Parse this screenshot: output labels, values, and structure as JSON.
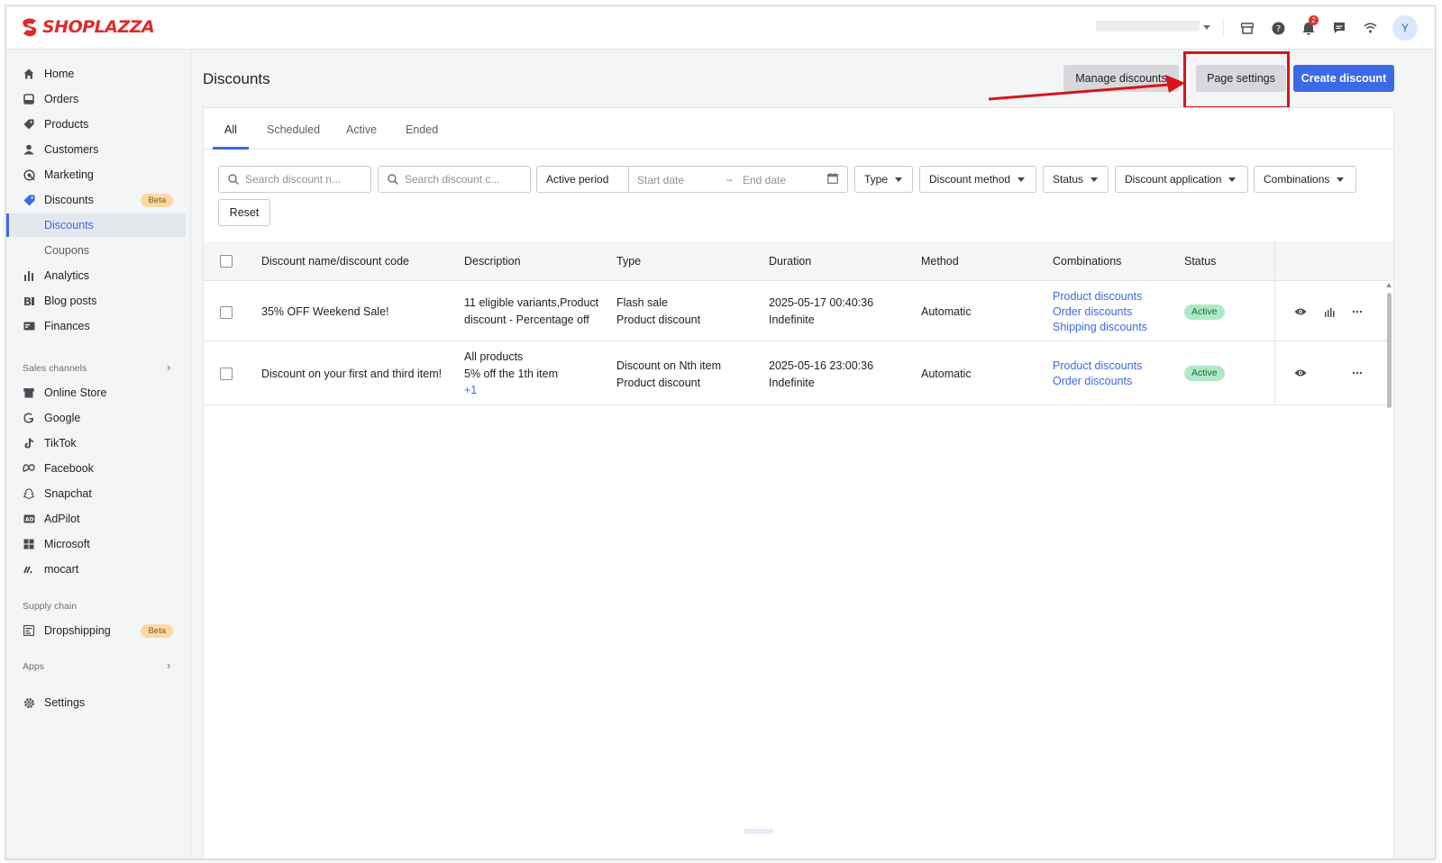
{
  "brand": {
    "name": "SHOPLAZZA",
    "color": "#e02a2a"
  },
  "topbar": {
    "icons": [
      "store-icon",
      "help-icon",
      "bell-icon",
      "chat-icon",
      "wifi-icon"
    ],
    "notification_count": "2",
    "avatar_initial": "Y"
  },
  "sidebar": {
    "items": [
      {
        "label": "Home",
        "icon": "home-icon"
      },
      {
        "label": "Orders",
        "icon": "orders-icon"
      },
      {
        "label": "Products",
        "icon": "tag-icon"
      },
      {
        "label": "Customers",
        "icon": "person-icon"
      },
      {
        "label": "Marketing",
        "icon": "marketing-icon"
      },
      {
        "label": "Discounts",
        "icon": "discount-icon",
        "badge": "Beta"
      },
      {
        "label": "Discounts"
      },
      {
        "label": "Coupons"
      },
      {
        "label": "Analytics",
        "icon": "bar-chart-icon"
      },
      {
        "label": "Blog posts",
        "icon": "blog-icon"
      },
      {
        "label": "Finances",
        "icon": "finance-icon"
      }
    ],
    "sales_channels_label": "Sales channels",
    "channels": [
      {
        "label": "Online Store",
        "icon": "store-icon"
      },
      {
        "label": "Google",
        "icon": "google-icon"
      },
      {
        "label": "TikTok",
        "icon": "tiktok-icon"
      },
      {
        "label": "Facebook",
        "icon": "meta-icon"
      },
      {
        "label": "Snapchat",
        "icon": "snapchat-icon"
      },
      {
        "label": "AdPilot",
        "icon": "adpilot-icon"
      },
      {
        "label": "Microsoft",
        "icon": "microsoft-icon"
      },
      {
        "label": "mocart",
        "icon": "mocart-icon"
      }
    ],
    "supply_chain_label": "Supply chain",
    "supply_items": [
      {
        "label": "Dropshipping",
        "icon": "dropshipping-icon",
        "badge": "Beta"
      }
    ],
    "apps_label": "Apps",
    "settings_label": "Settings"
  },
  "page": {
    "title": "Discounts",
    "manage_button": "Manage discounts",
    "page_settings_button": "Page settings",
    "create_button": "Create discount"
  },
  "tabs": [
    "All",
    "Scheduled",
    "Active",
    "Ended"
  ],
  "filters": {
    "search_name_placeholder": "Search discount n...",
    "search_code_placeholder": "Search discount c...",
    "active_period_label": "Active period",
    "start_date_placeholder": "Start date",
    "end_date_placeholder": "End date",
    "type": "Type",
    "method": "Discount method",
    "status": "Status",
    "application": "Discount application",
    "combinations": "Combinations",
    "reset": "Reset"
  },
  "table": {
    "headers": [
      "Discount name/discount code",
      "Description",
      "Type",
      "Duration",
      "Method",
      "Combinations",
      "Status"
    ],
    "rows": [
      {
        "name": "35% OFF Weekend Sale!",
        "description": [
          "11 eligible variants,Product",
          "discount - Percentage off"
        ],
        "type": [
          "Flash sale",
          "Product discount"
        ],
        "duration": [
          "2025-05-17 00:40:36",
          "Indefinite"
        ],
        "method": "Automatic",
        "combinations": [
          "Product discounts",
          "Order discounts",
          "Shipping discounts"
        ],
        "status": "Active"
      },
      {
        "name": "Discount on your first and third item!",
        "description": [
          "All products",
          "5% off the 1th item",
          "+1"
        ],
        "type": [
          "Discount on Nth item",
          "Product discount"
        ],
        "duration": [
          "2025-05-16 23:00:36",
          "Indefinite"
        ],
        "method": "Automatic",
        "combinations": [
          "Product discounts",
          "Order discounts"
        ],
        "status": "Active"
      }
    ]
  },
  "colors": {
    "accent": "#3b6ae8",
    "active_badge": "#aee9c6",
    "annotation": "#d4161a"
  }
}
